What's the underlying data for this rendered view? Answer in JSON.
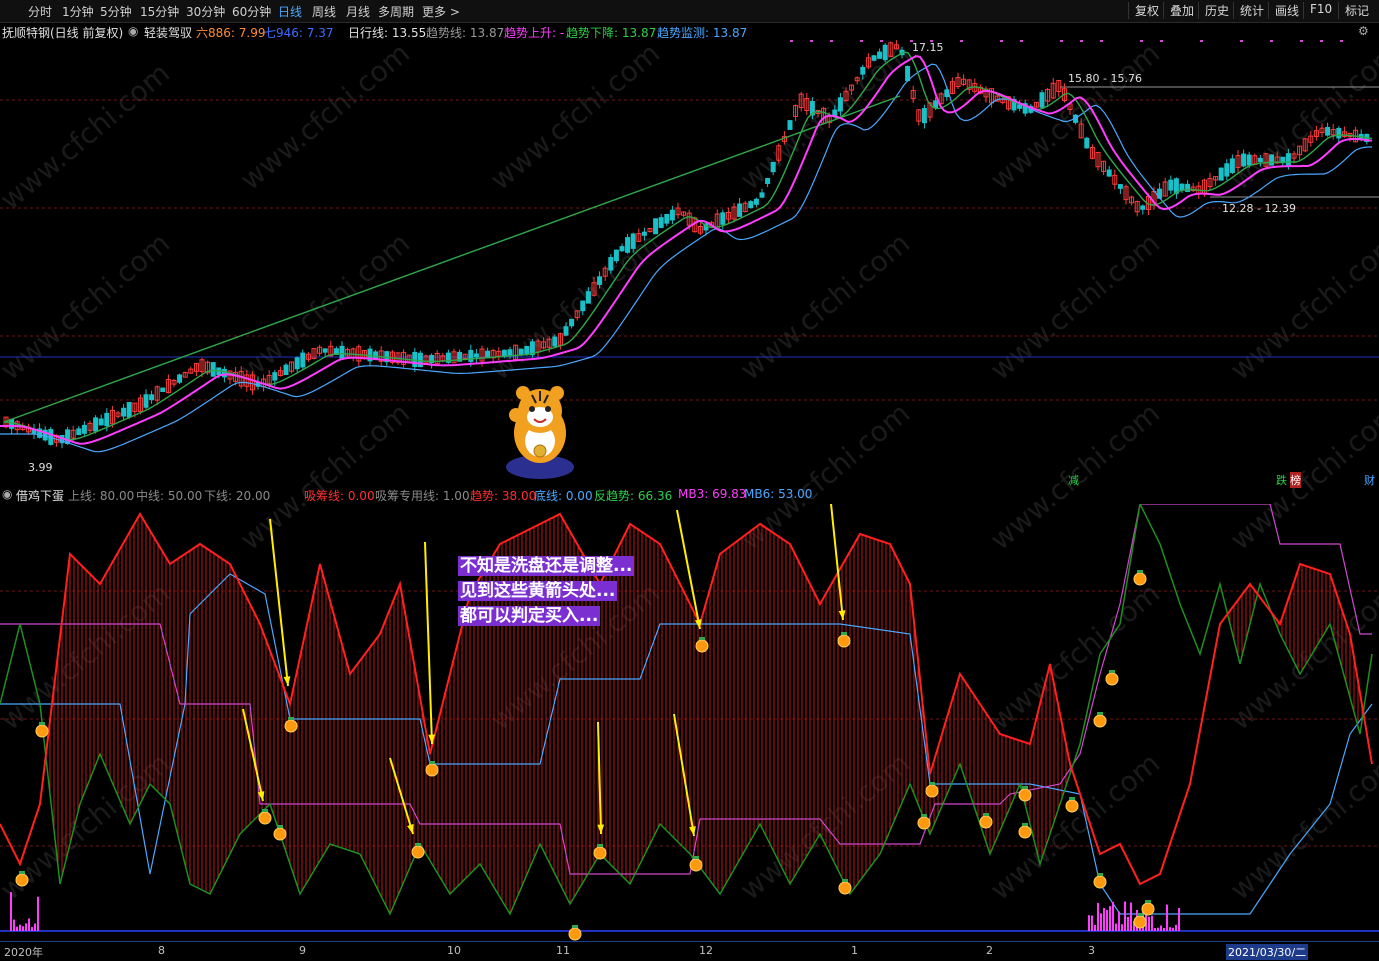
{
  "toolbar": {
    "periods": [
      "分时",
      "1分钟",
      "5分钟",
      "15分钟",
      "30分钟",
      "60分钟",
      "日线",
      "周线",
      "月线",
      "多周期",
      "更多 >"
    ],
    "active_period": "日线",
    "right_buttons": [
      "复权",
      "叠加",
      "历史",
      "统计",
      "画线",
      "F10",
      "标记"
    ]
  },
  "stock": {
    "name": "抚顺特钢(日线 前复权)",
    "indicator_name": "轻装驾驭",
    "six_label": "六886: 7.99",
    "seven_label": "七946: 7.37",
    "day_line": "日行线: 13.55",
    "trend_line": "趋势线: 13.87",
    "trend_up": "趋势上升: -",
    "trend_down": "趋势下降: 13.87",
    "trend_monitor": "趋势监测: 13.87"
  },
  "main_chart": {
    "price_labels": {
      "high": "17.15",
      "mid_range": "15.80 - 15.76",
      "low_range": "12.28 - 12.39",
      "start_low": "3.99"
    },
    "bottom_markers": {
      "reduce": "减",
      "fall": "跌",
      "ranking": "榜",
      "wealth": "财"
    }
  },
  "sub_chart": {
    "name": "借鸡下蛋",
    "upper": "上线: 80.00",
    "middle": "中线: 50.00",
    "lower": "下线: 20.00",
    "absorb": "吸筹线: 0.00",
    "absorb_special": "吸筹专用线: 1.00",
    "trend": "趋势: 38.00",
    "bottom": "底线: 0.00",
    "reverse_trend": "反趋势: 66.36",
    "mb3": "MB3: 69.83",
    "mb6": "MB6: 53.00"
  },
  "annotation": {
    "line1": "不知是洗盘还是调整...",
    "line2": "见到这些黄箭头处...",
    "line3": "都可以判定买入..."
  },
  "time_axis": {
    "labels": [
      "2020年",
      "8",
      "9",
      "10",
      "11",
      "12",
      "1",
      "2",
      "3"
    ],
    "cursor_date": "2021/03/30/二"
  },
  "watermark": "www.cfchi.com",
  "colors": {
    "candle_up": "#ff3b3b",
    "candle_down": "#19c0c8",
    "ma_pink": "#ff3dff",
    "ma_blue": "#4aa8ff",
    "ma_green": "#2fa84a",
    "sub_red": "#ff2020",
    "sub_green": "#1f8f1f",
    "sub_blue": "#4aa8ff",
    "sub_magenta": "#d048d0",
    "arrow_yellow": "#ffee00",
    "note_bg": "#7b2fd1"
  }
}
